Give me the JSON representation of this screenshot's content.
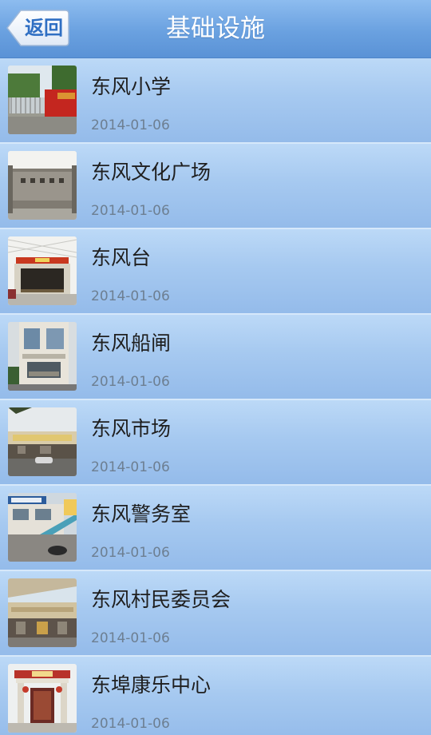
{
  "header": {
    "back_label": "返回",
    "title": "基础设施"
  },
  "items": [
    {
      "title": "东风小学",
      "date": "2014-01-06",
      "thumb_icon": "school-gate-photo"
    },
    {
      "title": "东风文化广场",
      "date": "2014-01-06",
      "thumb_icon": "plaza-wall-photo"
    },
    {
      "title": "东风台",
      "date": "2014-01-06",
      "thumb_icon": "stage-photo"
    },
    {
      "title": "东风船闸",
      "date": "2014-01-06",
      "thumb_icon": "ship-lock-building-photo"
    },
    {
      "title": "东风市场",
      "date": "2014-01-06",
      "thumb_icon": "market-photo"
    },
    {
      "title": "东风警务室",
      "date": "2014-01-06",
      "thumb_icon": "police-office-photo"
    },
    {
      "title": "东风村民委员会",
      "date": "2014-01-06",
      "thumb_icon": "village-committee-photo"
    },
    {
      "title": "东埠康乐中心",
      "date": "2014-01-06",
      "thumb_icon": "recreation-center-photo"
    }
  ],
  "colors": {
    "header_top": "#8dbcef",
    "header_bottom": "#5a92d6",
    "row_light": "#bcd9f7",
    "row_dark": "#94bbea",
    "back_text": "#2f6fc3",
    "date_text": "#6d7f92"
  }
}
